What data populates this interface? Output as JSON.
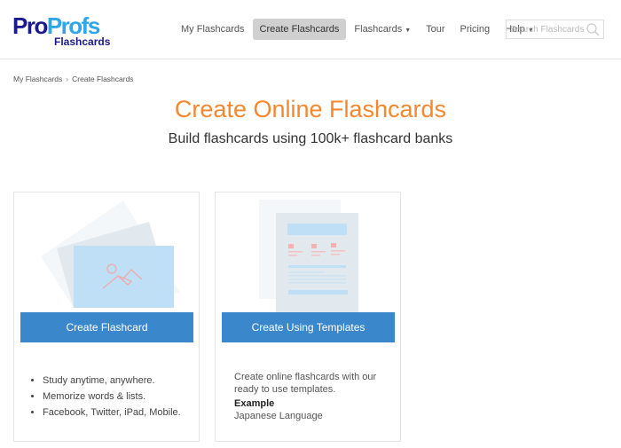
{
  "header": {
    "logo": {
      "pro": "Pro",
      "profs": "Profs",
      "sub": "Flashcards"
    },
    "nav": [
      {
        "label": "My Flashcards"
      },
      {
        "label": "Create Flashcards",
        "active": true
      },
      {
        "label": "Flashcards",
        "dropdown": true
      },
      {
        "label": "Tour"
      },
      {
        "label": "Pricing"
      },
      {
        "label": "Help",
        "dropdown": true
      }
    ],
    "search": {
      "placeholder": "Search Flashcards",
      "icon": "search-icon"
    }
  },
  "breadcrumb": [
    "My Flashcards",
    "Create Flashcards"
  ],
  "title": "Create Online Flashcards",
  "subtitle": "Build flashcards using 100k+ flashcard banks",
  "cards": [
    {
      "button": "Create Flashcard",
      "bullets": [
        "Study anytime, anywhere.",
        "Memorize words & lists.",
        "Facebook, Twitter, iPad, Mobile."
      ]
    },
    {
      "button": "Create Using Templates",
      "description": "Create online flashcards with our ready to use templates.",
      "example_label": "Example",
      "example_value": "Japanese Language"
    }
  ],
  "colors": {
    "accent": "#f5872e",
    "button": "#3b87cc",
    "logo_dark": "#1a1a8c",
    "logo_light": "#2ea6e8"
  }
}
